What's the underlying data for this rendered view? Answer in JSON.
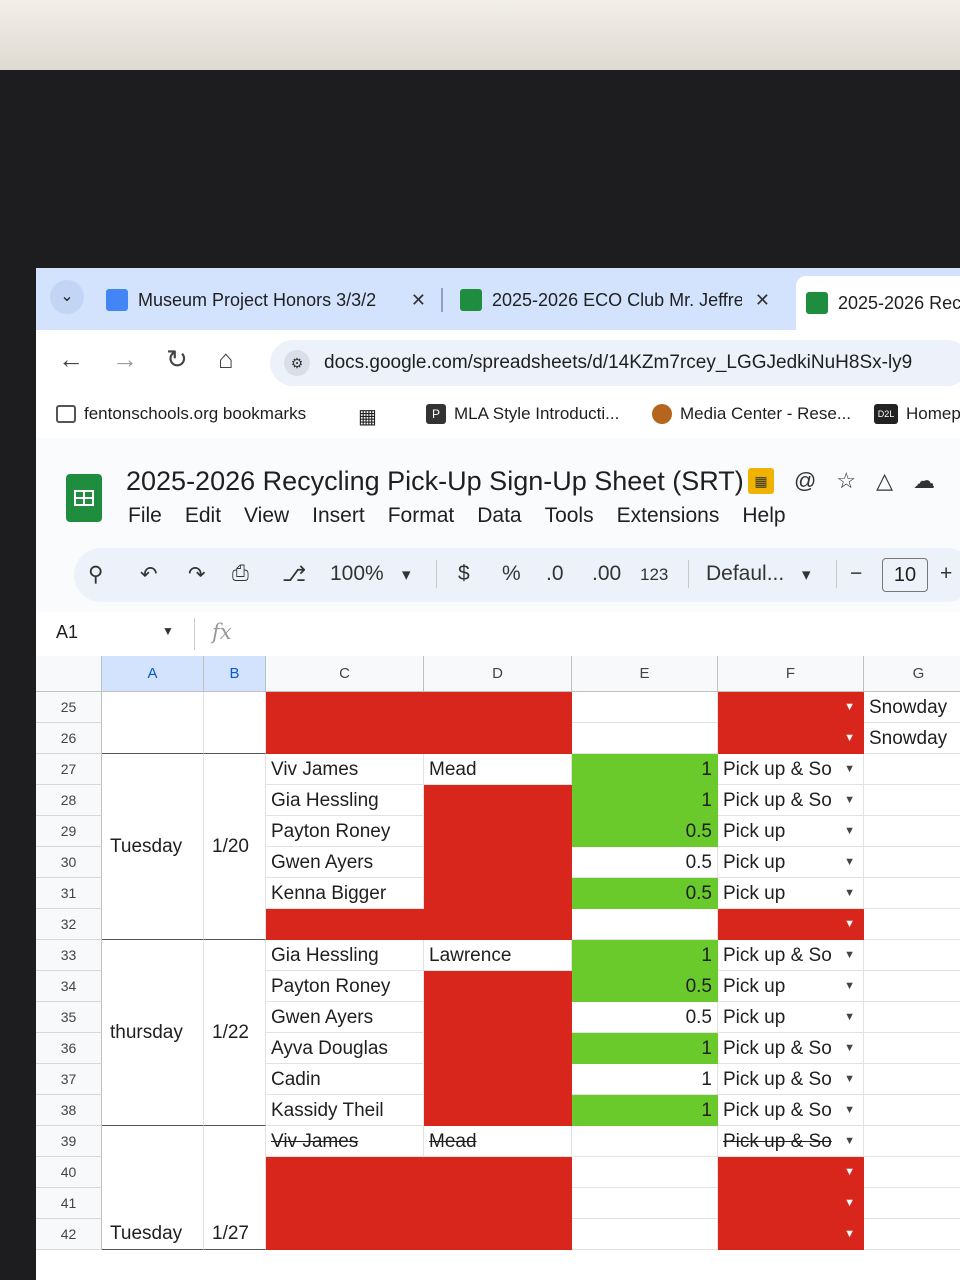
{
  "tabs": [
    {
      "title": "Museum Project Honors 3/3/2",
      "icon": "docs-icon",
      "color": "#4285f4"
    },
    {
      "title": "2025-2026 ECO Club Mr. Jeffre",
      "icon": "classroom-icon",
      "color": "#1e8e3e"
    },
    {
      "title": "2025-2026 Rec",
      "icon": "sheets-icon",
      "color": "#1e8e3e"
    }
  ],
  "url": "docs.google.com/spreadsheets/d/14KZm7rcey_LGGJedkiNuH8Sx-ly9",
  "bookmarks": [
    "fentonschools.org bookmarks",
    "MLA Style Introducti...",
    "Media Center - Rese...",
    "Homep"
  ],
  "bookmark_badge": "D2L",
  "doc": {
    "title": "2025-2026 Recycling Pick-Up Sign-Up Sheet (SRT)",
    "menu": [
      "File",
      "Edit",
      "View",
      "Insert",
      "Format",
      "Data",
      "Tools",
      "Extensions",
      "Help"
    ]
  },
  "toolbar": {
    "zoom": "100%",
    "currency": "$",
    "percent": "%",
    "dec_decrease": ".0",
    "dec_increase": ".00",
    "format_number": "123",
    "font": "Defaul...",
    "font_size": "10",
    "minus": "−",
    "plus": "+"
  },
  "formula": {
    "cell_ref": "A1",
    "fx": "fx"
  },
  "columns": [
    "A",
    "B",
    "C",
    "D",
    "E",
    "F",
    "G"
  ],
  "rows": [
    {
      "n": "25",
      "c": "",
      "d": "",
      "e": "",
      "f": "",
      "g": "Snowday"
    },
    {
      "n": "26",
      "c": "",
      "d": "",
      "e": "",
      "f": "",
      "g": "Snowday"
    },
    {
      "n": "27",
      "c": "Viv James",
      "d": "Mead",
      "e": "1",
      "f": "Pick up & So",
      "g": ""
    },
    {
      "n": "28",
      "c": "Gia Hessling",
      "d": "",
      "e": "1",
      "f": "Pick up & So",
      "g": ""
    },
    {
      "n": "29",
      "c": "Payton Roney",
      "d": "",
      "e": "0.5",
      "f": "Pick up",
      "g": ""
    },
    {
      "n": "30",
      "c": "Gwen Ayers",
      "d": "",
      "e": "0.5",
      "f": "Pick up",
      "g": ""
    },
    {
      "n": "31",
      "c": "Kenna Bigger",
      "d": "",
      "e": "0.5",
      "f": "Pick up",
      "g": ""
    },
    {
      "n": "32",
      "c": "",
      "d": "",
      "e": "",
      "f": "",
      "g": ""
    },
    {
      "n": "33",
      "c": "Gia Hessling",
      "d": "Lawrence",
      "e": "1",
      "f": "Pick up & So",
      "g": ""
    },
    {
      "n": "34",
      "c": "Payton Roney",
      "d": "",
      "e": "0.5",
      "f": "Pick up",
      "g": ""
    },
    {
      "n": "35",
      "c": "Gwen Ayers",
      "d": "",
      "e": "0.5",
      "f": "Pick up",
      "g": ""
    },
    {
      "n": "36",
      "c": "Ayva Douglas",
      "d": "",
      "e": "1",
      "f": "Pick up & So",
      "g": ""
    },
    {
      "n": "37",
      "c": "Cadin",
      "d": "",
      "e": "1",
      "f": "Pick up & So",
      "g": ""
    },
    {
      "n": "38",
      "c": "Kassidy Theil",
      "d": "",
      "e": "1",
      "f": "Pick up & So",
      "g": ""
    },
    {
      "n": "39",
      "c": "Viv James",
      "d": "Mead",
      "e": "",
      "f": "Pick up & So",
      "g": ""
    },
    {
      "n": "40",
      "c": "",
      "d": "",
      "e": "",
      "f": "",
      "g": ""
    },
    {
      "n": "41",
      "c": "",
      "d": "",
      "e": "",
      "f": "",
      "g": ""
    },
    {
      "n": "42",
      "c": "",
      "d": "",
      "e": "",
      "f": "",
      "g": ""
    }
  ],
  "groups": [
    {
      "day": "Tuesday",
      "date": "1/20"
    },
    {
      "day": "thursday",
      "date": "1/22"
    },
    {
      "day": "Tuesday",
      "date": "1/27"
    }
  ],
  "colors": {
    "red": "#d9261c",
    "green": "#6ac92b",
    "tabbar": "#d3e3fd"
  }
}
